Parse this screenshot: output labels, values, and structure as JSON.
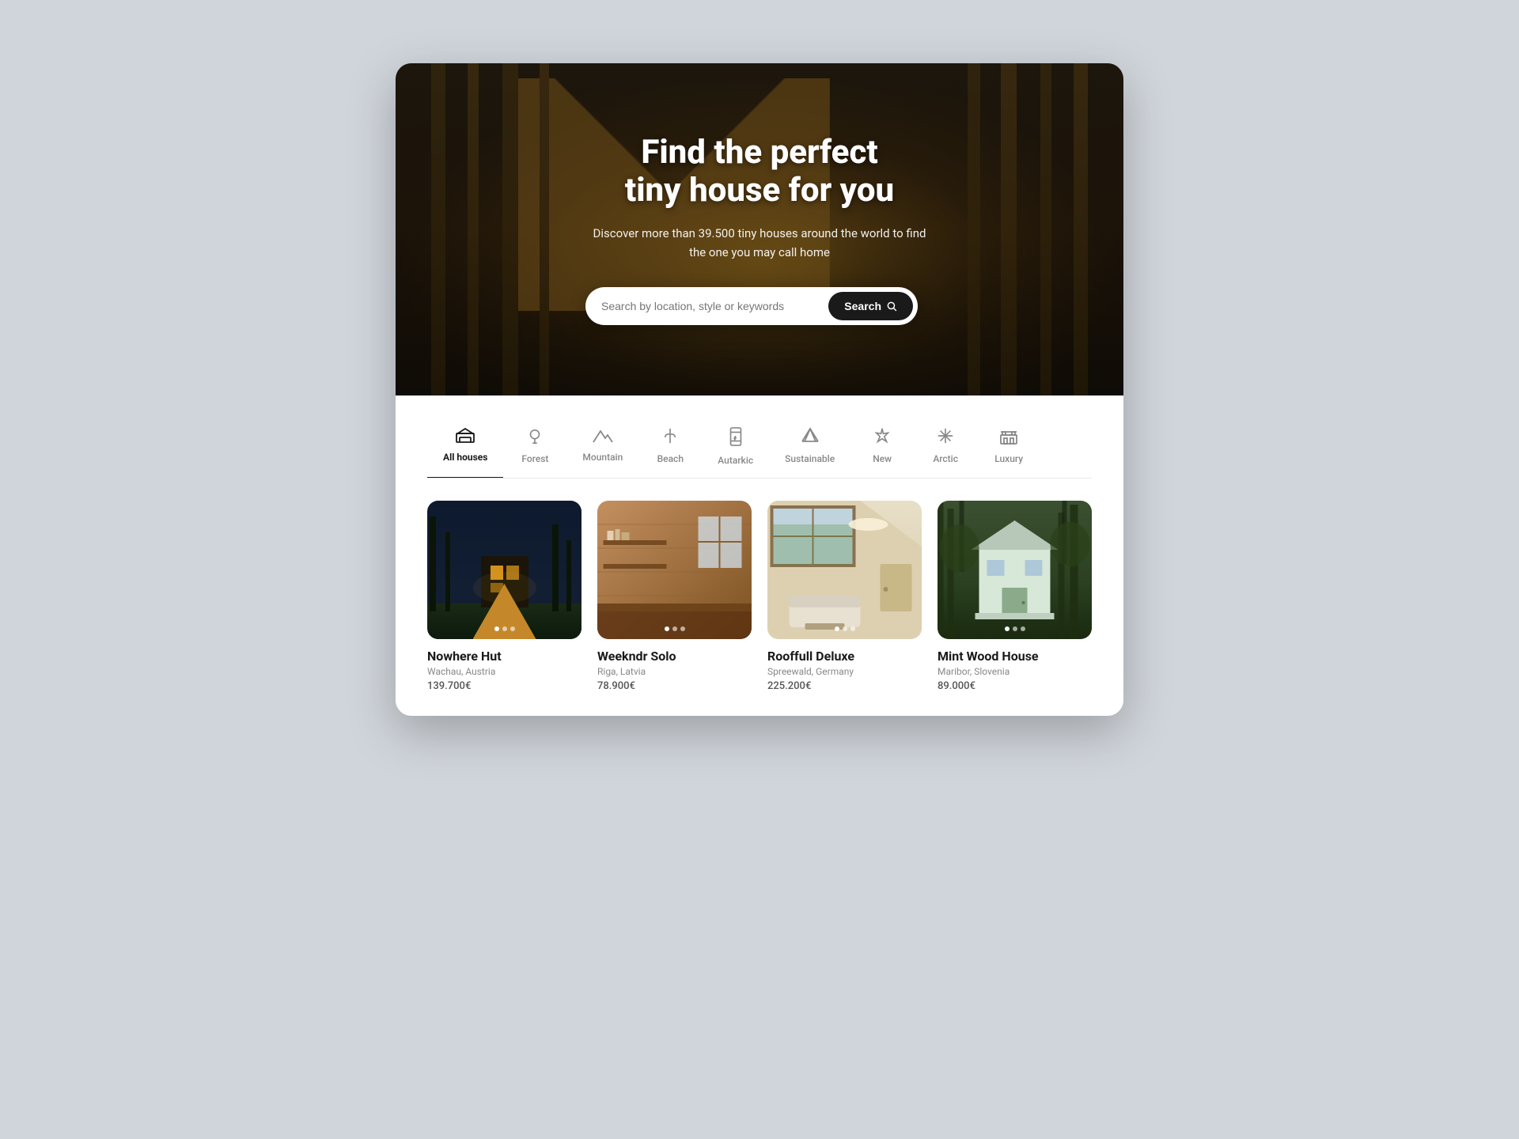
{
  "hero": {
    "title": "Find the perfect\ntiny house for you",
    "subtitle": "Discover more than 39.500 tiny houses around the world to find the one you may call home",
    "search_placeholder": "Search by location, style or keywords",
    "search_button": "Search"
  },
  "categories": [
    {
      "id": "all",
      "label": "All houses",
      "icon": "🏠",
      "active": true
    },
    {
      "id": "forest",
      "label": "Forest",
      "icon": "🌳",
      "active": false
    },
    {
      "id": "mountain",
      "label": "Mountain",
      "icon": "⛰️",
      "active": false
    },
    {
      "id": "beach",
      "label": "Beach",
      "icon": "🌴",
      "active": false
    },
    {
      "id": "autarkic",
      "label": "Autarkic",
      "icon": "🔋",
      "active": false
    },
    {
      "id": "sustainable",
      "label": "Sustainable",
      "icon": "♻️",
      "active": false
    },
    {
      "id": "new",
      "label": "New",
      "icon": "✦",
      "active": false
    },
    {
      "id": "arctic",
      "label": "Arctic",
      "icon": "❄",
      "active": false
    },
    {
      "id": "luxury",
      "label": "Luxury",
      "icon": "🏛",
      "active": false
    }
  ],
  "properties": [
    {
      "id": "nowhere-hut",
      "name": "Nowhere Hut",
      "location": "Wachau, Austria",
      "price": "139.700€",
      "dots": 3,
      "active_dot": 0
    },
    {
      "id": "weekndr-solo",
      "name": "Weekndr Solo",
      "location": "Riga, Latvia",
      "price": "78.900€",
      "dots": 3,
      "active_dot": 0
    },
    {
      "id": "rooffull-deluxe",
      "name": "Rooffull Deluxe",
      "location": "Spreewald, Germany",
      "price": "225.200€",
      "dots": 3,
      "active_dot": 0
    },
    {
      "id": "mint-wood-house",
      "name": "Mint Wood House",
      "location": "Maribor, Slovenia",
      "price": "89.000€",
      "dots": 3,
      "active_dot": 0
    }
  ]
}
